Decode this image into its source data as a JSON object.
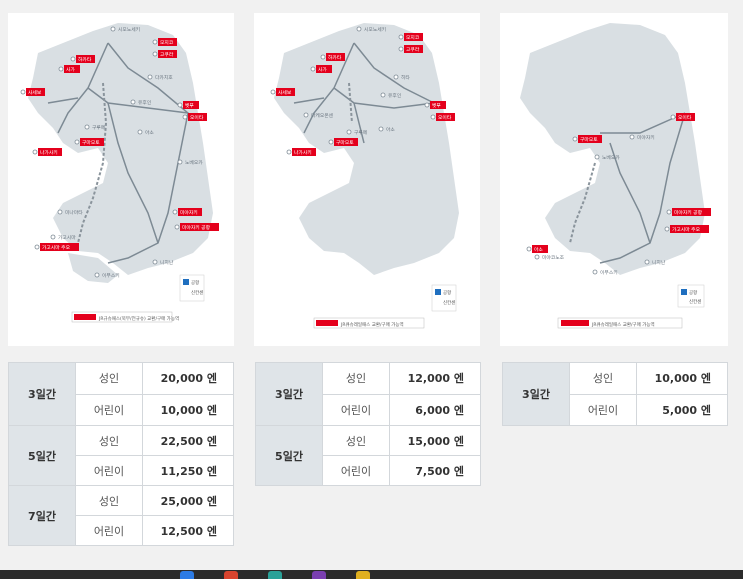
{
  "maps": [
    {
      "legend_line": "JR규슈패스(북부/전규슈) 교환/구매 가능역",
      "legend_airport": "공항",
      "legend_shinkansen": "신칸센",
      "stations": [
        "시모노세키",
        "모지코",
        "고쿠라",
        "하카타",
        "사가",
        "사세보",
        "벳푸",
        "오이타",
        "구마모토",
        "나가사키",
        "가고시마 주오",
        "미야자키",
        "미야자키 공항",
        "이부스키",
        "가고시마",
        "유후인",
        "구루메",
        "아소",
        "다카치호",
        "미나마타",
        "노베오카",
        "니치난"
      ]
    },
    {
      "legend_line": "JR큐슈레일패스 교환/구매 가능역",
      "legend_airport": "공항",
      "legend_shinkansen": "신칸센",
      "stations": [
        "시모노세키",
        "모지코",
        "고쿠라",
        "하카타",
        "사가",
        "사세보",
        "벳푸",
        "오이타",
        "구마모토",
        "나가사키",
        "유후인",
        "아소",
        "구루메",
        "히타",
        "다케오온센"
      ]
    },
    {
      "legend_line": "JR큐슈레일패스 교환/구매 가능역",
      "legend_airport": "공항",
      "legend_shinkansen": "신칸센",
      "stations": [
        "오이타",
        "구마모토",
        "미야자키",
        "미야자키 공항",
        "가고시마 주오",
        "아소",
        "노베오카",
        "이부스키",
        "니치난",
        "미야코노조"
      ]
    }
  ],
  "tables": [
    {
      "rows": [
        {
          "duration": "3일간",
          "adult_label": "성인",
          "adult_price": "20,000 엔",
          "child_label": "어린이",
          "child_price": "10,000 엔"
        },
        {
          "duration": "5일간",
          "adult_label": "성인",
          "adult_price": "22,500 엔",
          "child_label": "어린이",
          "child_price": "11,250 엔"
        },
        {
          "duration": "7일간",
          "adult_label": "성인",
          "adult_price": "25,000 엔",
          "child_label": "어린이",
          "child_price": "12,500 엔"
        }
      ]
    },
    {
      "rows": [
        {
          "duration": "3일간",
          "adult_label": "성인",
          "adult_price": "12,000 엔",
          "child_label": "어린이",
          "child_price": "6,000 엔"
        },
        {
          "duration": "5일간",
          "adult_label": "성인",
          "adult_price": "15,000 엔",
          "child_label": "어린이",
          "child_price": "7,500 엔"
        }
      ]
    },
    {
      "rows": [
        {
          "duration": "3일간",
          "adult_label": "성인",
          "adult_price": "10,000 엔",
          "child_label": "어린이",
          "child_price": "5,000 엔"
        }
      ]
    }
  ],
  "colors": {
    "map_land": "#d9dfe3",
    "route": "#7d8a94",
    "label_red": "#e4001c",
    "shinkansen": "#8a949c"
  }
}
